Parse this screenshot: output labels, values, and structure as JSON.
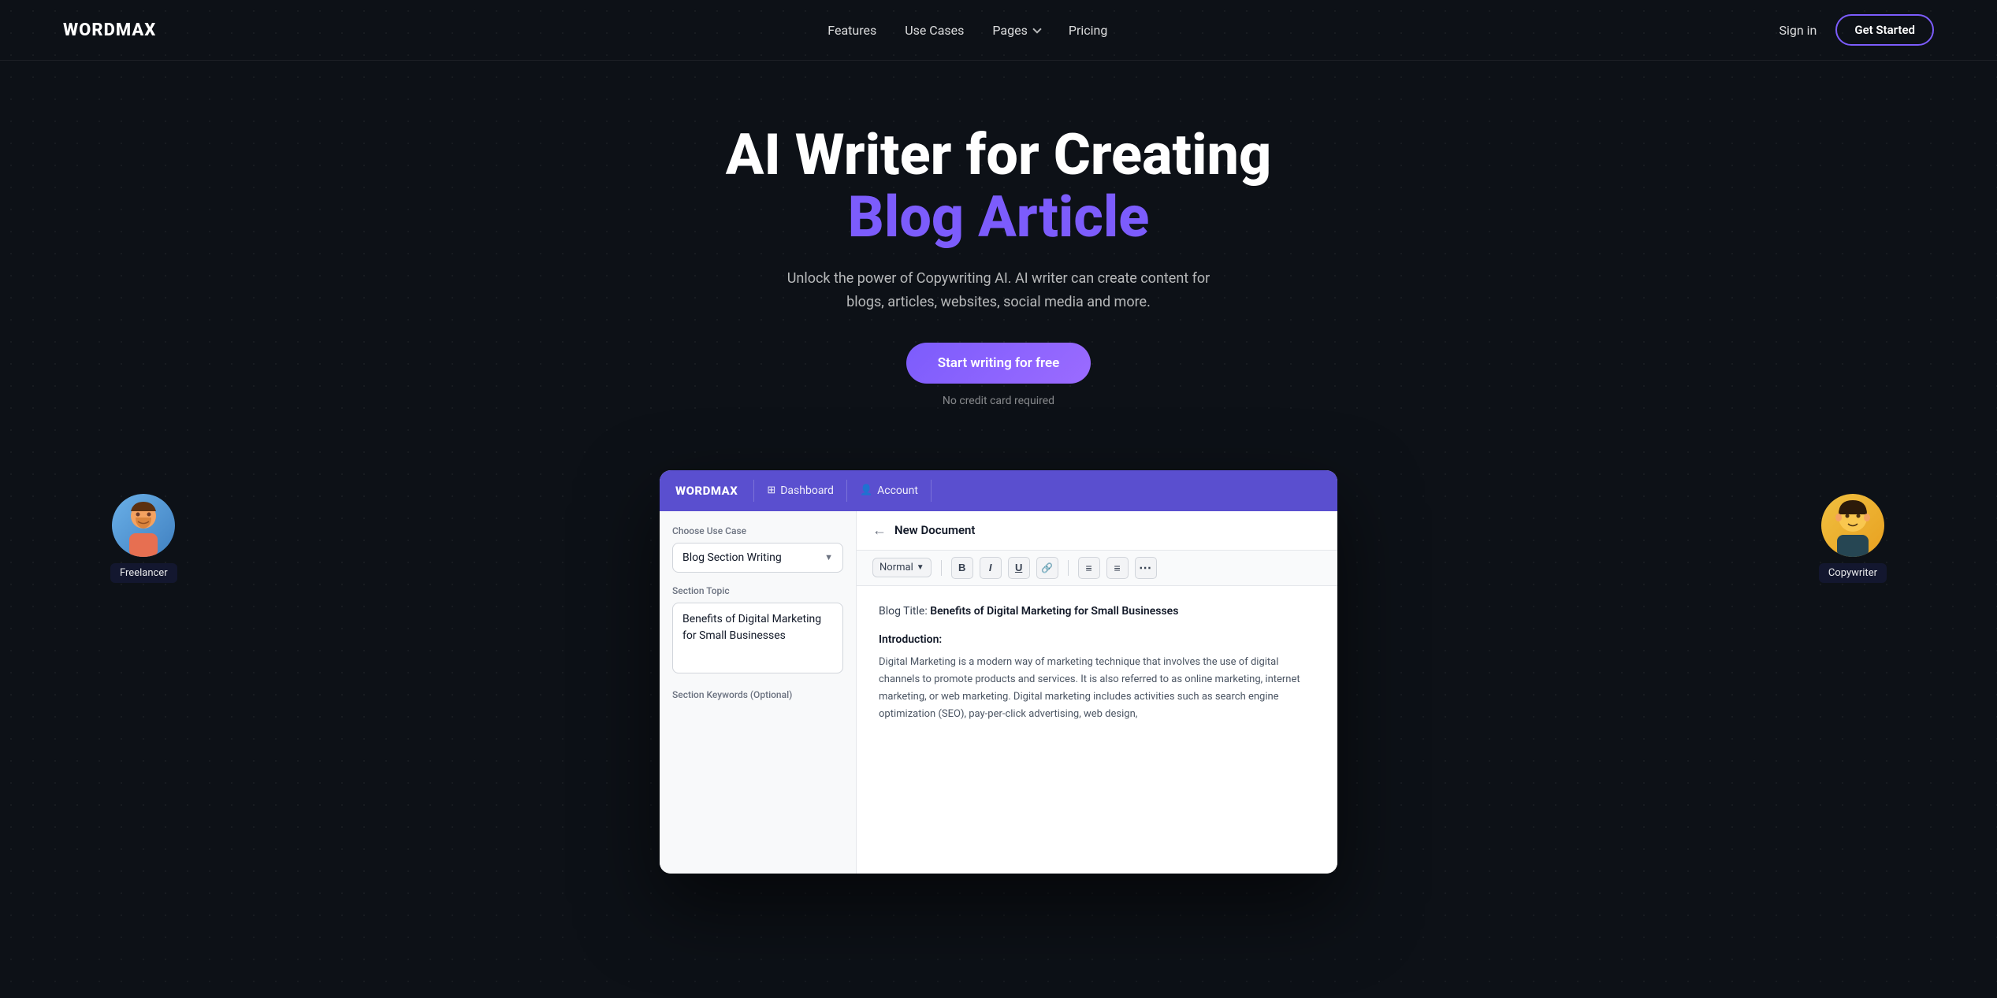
{
  "nav": {
    "logo": "WORDMAX",
    "links": [
      {
        "label": "Features",
        "dropdown": false
      },
      {
        "label": "Use Cases",
        "dropdown": false
      },
      {
        "label": "Pages",
        "dropdown": true
      },
      {
        "label": "Pricing",
        "dropdown": false
      }
    ],
    "signin_label": "Sign in",
    "getstarted_label": "Get Started"
  },
  "hero": {
    "title_line1": "AI Writer for Creating",
    "title_line2": "Blog Article",
    "subtitle": "Unlock the power of Copywriting AI. AI writer can create content for blogs, articles, websites, social media and more.",
    "cta_label": "Start writing for free",
    "cta_note": "No credit card required"
  },
  "avatars": {
    "freelancer_label": "Freelancer",
    "copywriter_label": "Copywriter"
  },
  "app": {
    "logo": "WORDMAX",
    "nav_dashboard": "Dashboard",
    "nav_account": "Account",
    "sidebar": {
      "use_case_label": "Choose Use Case",
      "use_case_value": "Blog Section Writing",
      "topic_label": "Section Topic",
      "topic_value": "Benefits of Digital Marketing for Small Businesses",
      "keywords_label": "Section Keywords (Optional)"
    },
    "editor": {
      "back_label": "New Document",
      "toolbar": {
        "format": "Normal",
        "bold": "B",
        "italic": "I",
        "underline": "U",
        "link": "🔗",
        "list_ordered": "≡",
        "list_unordered": "≡",
        "more": "⋯"
      },
      "blog_title_prefix": "Blog Title:",
      "blog_title": "Benefits of Digital Marketing for Small Businesses",
      "intro_heading": "Introduction:",
      "intro_text": "Digital Marketing is a modern way of marketing technique that involves the use of digital channels to promote products and services. It is also referred to as online marketing, internet marketing, or web marketing. Digital marketing includes activities such as search engine optimization (SEO), pay-per-click advertising, web design,"
    }
  }
}
